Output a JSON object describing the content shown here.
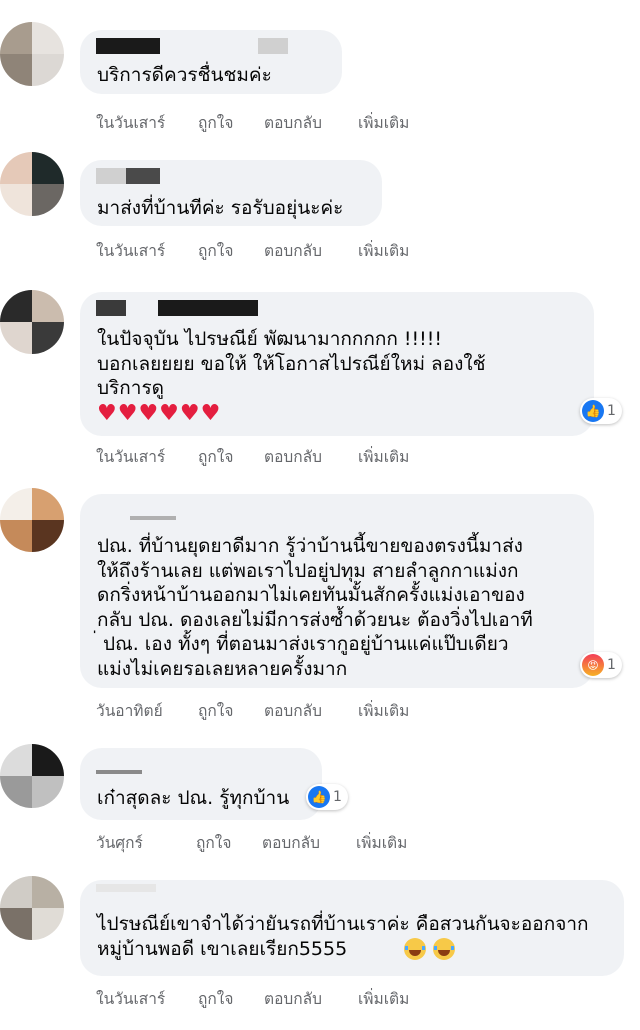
{
  "comments": [
    {
      "text": "บริการดีควรชื่นชมค่ะ",
      "time": "ในวันเสาร์"
    },
    {
      "text": "มาส่งที่บ้านทีค่ะ รอรับอยุ่นะค่ะ",
      "time": "ในวันเสาร์"
    },
    {
      "text": "ในปัจจุบัน ไปรษณีย์ พัฒนามากกกกก !!!!!\nบอกเลยยยย ขอให้ ให้โอกาสไปรณีย์ใหม่ ลองใช้\nบริการดู",
      "hearts": "♥♥♥♥♥♥",
      "time": "ในวันเสาร์",
      "reaction": {
        "icon": "like-icon",
        "count": "1"
      }
    },
    {
      "text": "ปณ. ที่บ้านยุดยาดีมาก รู้ว่าบ้านนี้ขายของตรงนี้มาส่ง\nให้ถึงร้านเลย แต่พอเราไปอยู่ปทุม สายลำลูกกาแม่งก\nดกริ่งหน้าบ้านออกมาไม่เคยทันมั้นสักครั้งแม่งเอาของ\nกลับ ปณ. ดองเลยไม่มีการส่งซ้ำด้วยนะ ต้องวิ่งไปเอาที\n่ ปณ. เอง ทั้งๆ ที่ตอนมาส่งเรากูอยู่บ้านแค่แป๊บเดียว\nแม่งไม่เคยรอเลยหลายครั้งมาก",
      "time": "วันอาทิตย์",
      "reaction": {
        "icon": "angry-icon",
        "count": "1"
      }
    },
    {
      "text": "เก๋าสุดละ ปณ. รู้ทุกบ้าน",
      "time": "วันศุกร์",
      "reaction": {
        "icon": "like-icon",
        "count": "1"
      }
    },
    {
      "text": "ไปรษณีย์เขาจำได้ว่ายันรถที่บ้านเราค่ะ คือสวนกันจะออกจาก\nหมู่บ้านพอดี เขาเลยเรียก5555",
      "time": "ในวันเสาร์",
      "emojis": [
        "tears-of-joy-emoji",
        "tears-of-joy-emoji"
      ]
    }
  ],
  "actions": {
    "like": "ถูกใจ",
    "reply": "ตอบกลับ",
    "more": "เพิ่มเติม"
  },
  "colors": {
    "bubble": "#f0f2f5",
    "action_text": "#65676b",
    "like": "#1877f2",
    "heart": "#e41e3f"
  }
}
